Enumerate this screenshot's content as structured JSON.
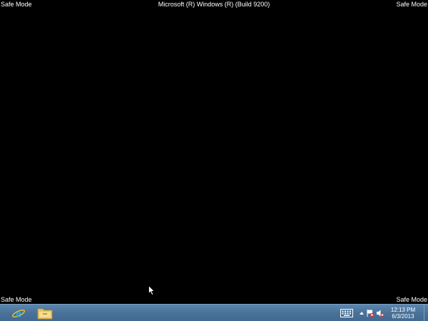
{
  "overlay": {
    "top_left": "Safe Mode",
    "top_right": "Safe Mode",
    "title": "Microsoft (R) Windows (R) (Build 9200)",
    "bottom_left": "Safe Mode",
    "bottom_right": "Safe Mode"
  },
  "taskbar": {
    "pinned": [
      {
        "name": "Internet Explorer",
        "icon": "internet-explorer-icon"
      },
      {
        "name": "File Explorer",
        "icon": "folder-icon"
      }
    ],
    "tray": {
      "icons": [
        "keyboard-icon",
        "chevron-up-icon",
        "action-center-flag-icon",
        "volume-muted-icon"
      ],
      "time": "12:13 PM",
      "date": "6/3/2013"
    }
  },
  "colors": {
    "desktop": "#000000",
    "taskbar": "#4a7299",
    "text": "#ffffff"
  }
}
